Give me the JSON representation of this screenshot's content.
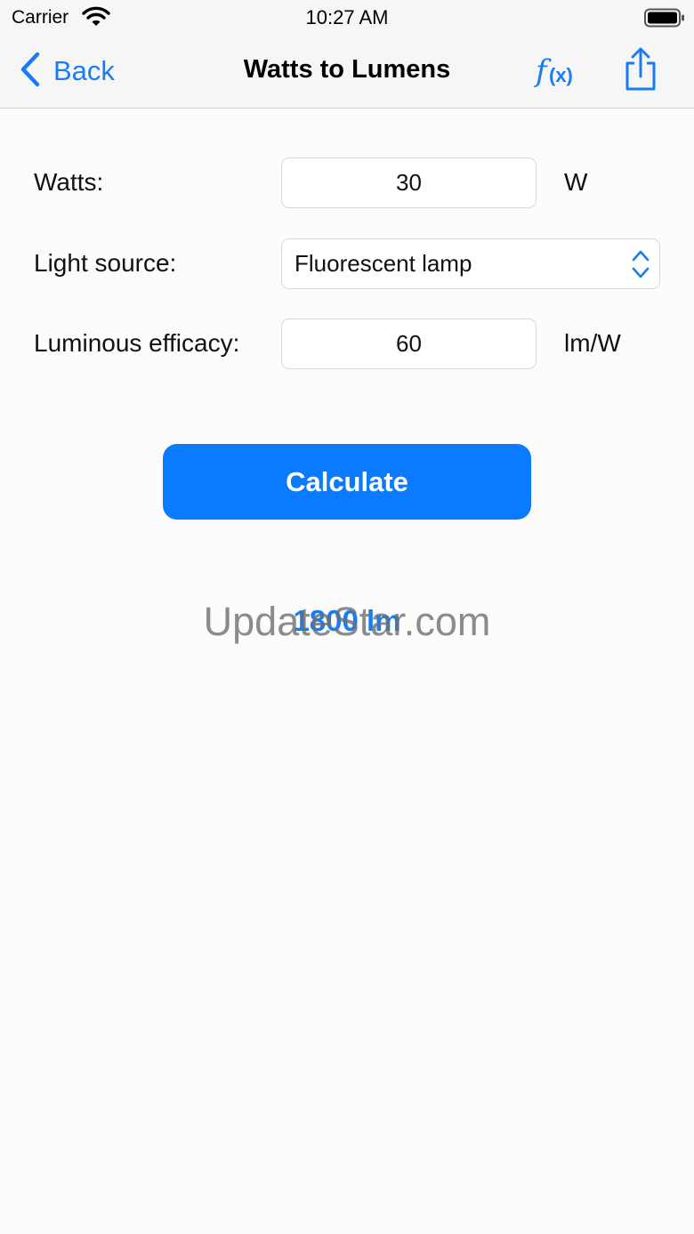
{
  "status_bar": {
    "carrier": "Carrier",
    "time": "10:27 AM"
  },
  "nav": {
    "back_label": "Back",
    "title": "Watts to Lumens",
    "formula_icon": "function-fx-icon",
    "share_icon": "share-icon"
  },
  "form": {
    "watts": {
      "label": "Watts:",
      "value": "30",
      "unit": "W"
    },
    "light_source": {
      "label": "Light source:",
      "value": "Fluorescent lamp"
    },
    "efficacy": {
      "label": "Luminous efficacy:",
      "value": "60",
      "unit": "lm/W"
    }
  },
  "calculate_label": "Calculate",
  "result": "1800 lm",
  "watermark": "UpdateStar.com",
  "colors": {
    "accent": "#1a7cf2",
    "button": "#0a7bff",
    "background": "#fcfcfc"
  }
}
